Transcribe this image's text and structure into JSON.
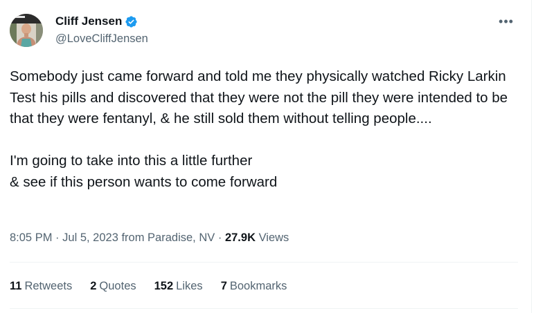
{
  "author": {
    "display_name": "Cliff Jensen",
    "handle": "@LoveCliffJensen",
    "verified": true,
    "verified_color": "#1d9bf0"
  },
  "more_icon": "ellipsis-icon",
  "tweet": {
    "paragraphs": [
      "Somebody just came forward and told me they physically watched Ricky Larkin Test his pills and discovered that they were not the pill they were intended to be that they were fentanyl, & he still sold them without telling people....",
      "I'm going to take into this a little further\n& see if this person wants to come forward"
    ]
  },
  "meta": {
    "time": "8:05 PM",
    "separator": "·",
    "date": "Jul 5, 2023",
    "location": "from Paradise, NV",
    "views_count": "27.9K",
    "views_label": "Views"
  },
  "stats": {
    "retweets_count": "11",
    "retweets_label": "Retweets",
    "quotes_count": "2",
    "quotes_label": "Quotes",
    "likes_count": "152",
    "likes_label": "Likes",
    "bookmarks_count": "7",
    "bookmarks_label": "Bookmarks"
  },
  "colors": {
    "text_primary": "#0f1419",
    "text_secondary": "#536471",
    "divider": "#eff3f4",
    "brand_blue": "#1d9bf0"
  }
}
